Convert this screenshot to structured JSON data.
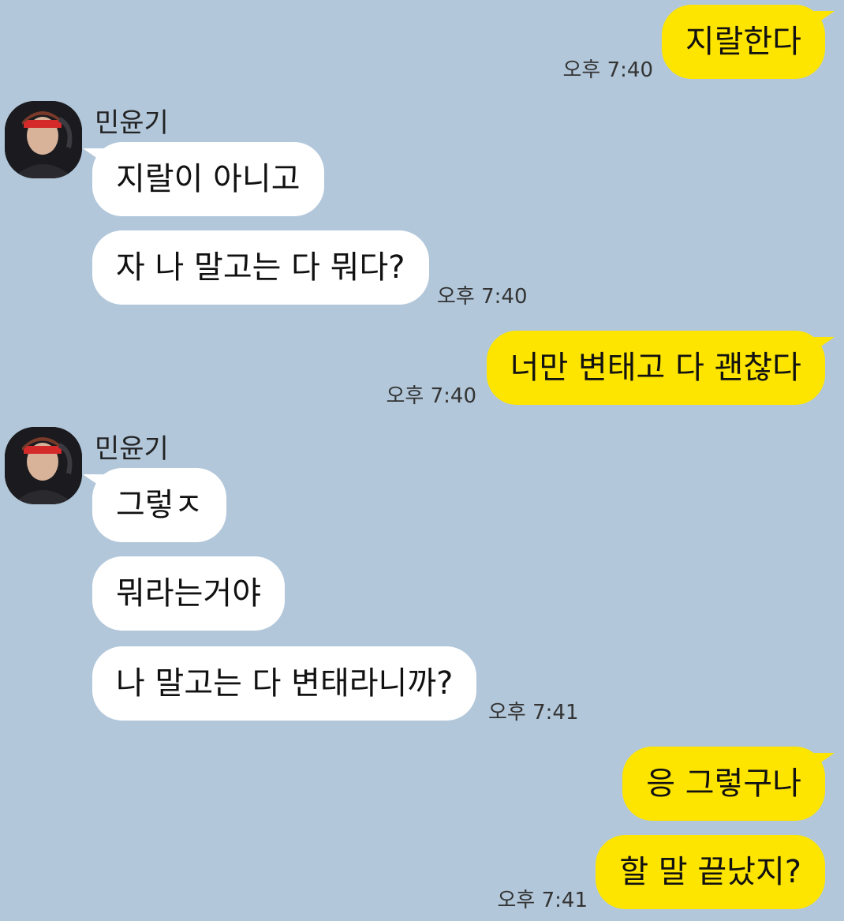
{
  "colors": {
    "background": "#b2c7da",
    "mine_bubble": "#fee500",
    "their_bubble": "#ffffff"
  },
  "sender_name": "민윤기",
  "messages": [
    {
      "text": "지랄한다",
      "time": "오후 7:40"
    },
    {
      "text": "지랄이 아니고"
    },
    {
      "text": "자 나 말고는 다 뭐다?",
      "time": "오후 7:40"
    },
    {
      "text": "너만 변태고 다 괜찮다",
      "time": "오후 7:40"
    },
    {
      "text": "그렇ㅈ"
    },
    {
      "text": "뭐라는거야"
    },
    {
      "text": "나 말고는 다 변태라니까?",
      "time": "오후 7:41"
    },
    {
      "text": "응 그렇구나"
    },
    {
      "text": "할 말 끝났지?",
      "time": "오후 7:41"
    }
  ],
  "icons": {
    "avatar": "profile-photo-avatar"
  }
}
